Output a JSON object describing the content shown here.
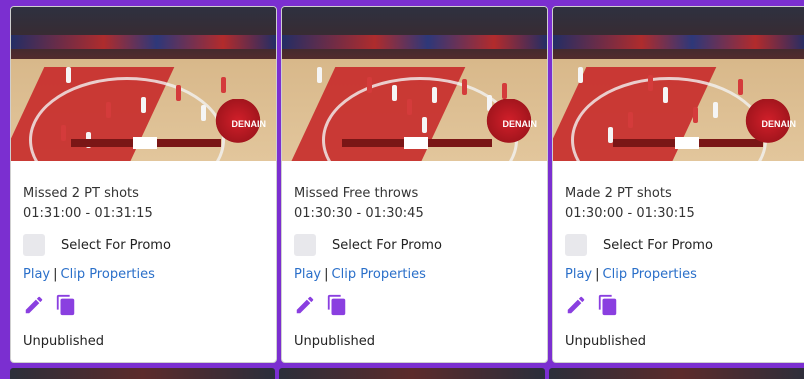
{
  "cards": [
    {
      "title": "Missed 2 PT shots",
      "time_range": "01:31:00 - 01:31:15",
      "promo_label": "Select For Promo",
      "play_label": "Play",
      "separator": "|",
      "properties_label": "Clip Properties",
      "status": "Unpublished",
      "thumb_team_text": "DENAIN"
    },
    {
      "title": "Missed Free throws",
      "time_range": "01:30:30 - 01:30:45",
      "promo_label": "Select For Promo",
      "play_label": "Play",
      "separator": "|",
      "properties_label": "Clip Properties",
      "status": "Unpublished",
      "thumb_team_text": "DENAIN"
    },
    {
      "title": "Made 2 PT shots",
      "time_range": "01:30:00 - 01:30:15",
      "promo_label": "Select For Promo",
      "play_label": "Play",
      "separator": "|",
      "properties_label": "Clip Properties",
      "status": "Unpublished",
      "thumb_team_text": "DENAIN"
    }
  ],
  "icons": {
    "edit": "pencil-icon",
    "copy": "copy-icon"
  },
  "colors": {
    "accent": "#7b2fd0",
    "link": "#2a6fc9",
    "icon": "#8a3fe0"
  }
}
